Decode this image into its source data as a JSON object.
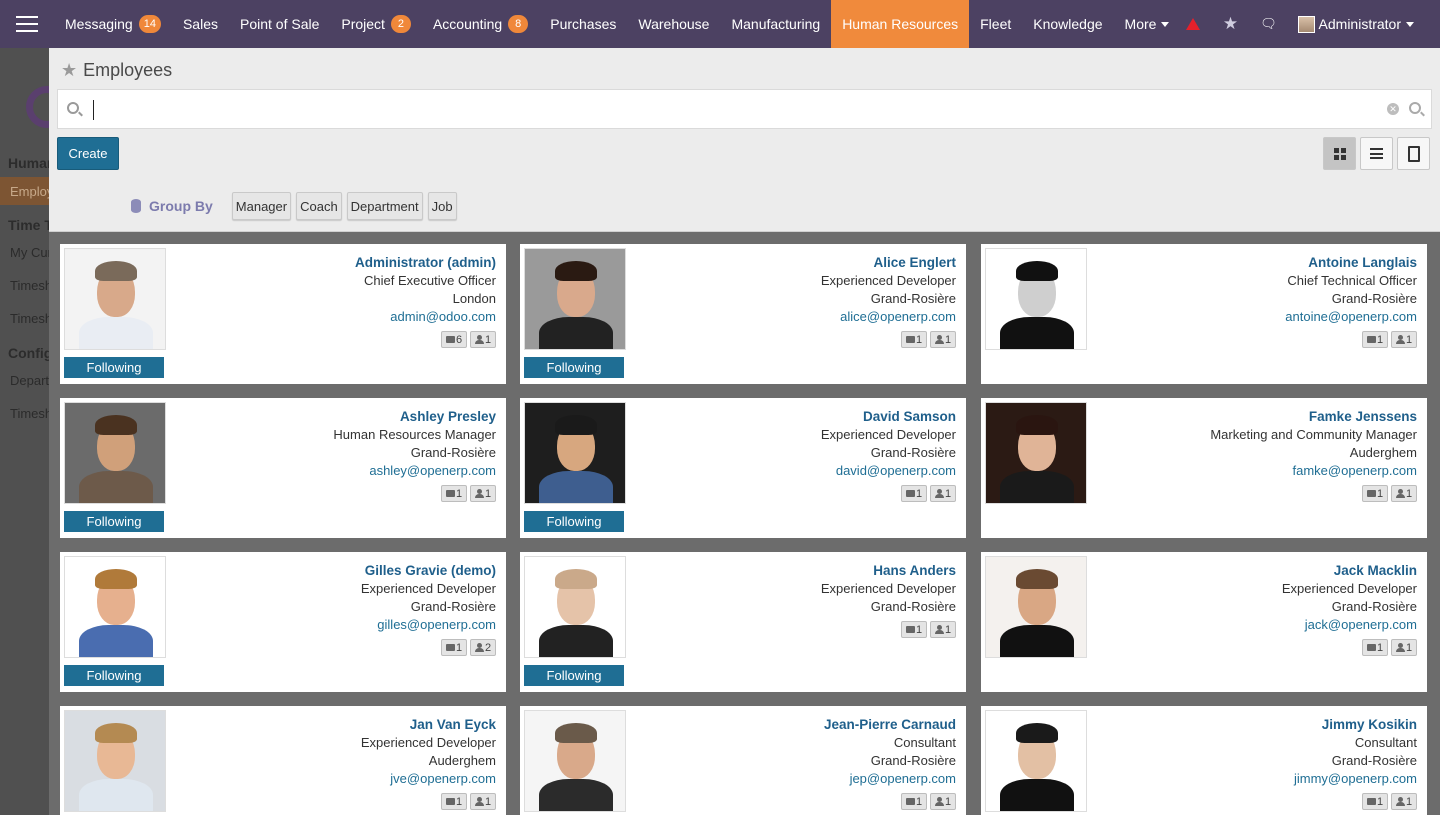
{
  "navbar": {
    "menus": [
      {
        "label": "Messaging",
        "badge": "14"
      },
      {
        "label": "Sales",
        "badge": ""
      },
      {
        "label": "Point of Sale",
        "badge": ""
      },
      {
        "label": "Project",
        "badge": "2"
      },
      {
        "label": "Accounting",
        "badge": "8"
      },
      {
        "label": "Purchases",
        "badge": ""
      },
      {
        "label": "Warehouse",
        "badge": ""
      },
      {
        "label": "Manufacturing",
        "badge": ""
      },
      {
        "label": "Human Resources",
        "badge": "",
        "active": true
      },
      {
        "label": "Fleet",
        "badge": ""
      },
      {
        "label": "Knowledge",
        "badge": ""
      },
      {
        "label": "More",
        "badge": ""
      }
    ],
    "user": "Administrator",
    "accent_color": "#4c4162",
    "active_color": "#f08a3c"
  },
  "sidebar": {
    "items": [
      {
        "label": "Human Resources",
        "type": "head"
      },
      {
        "label": "Employees",
        "type": "active"
      },
      {
        "label": "Time Tracking",
        "type": "head"
      },
      {
        "label": "My Current Timesheet",
        "type": "item"
      },
      {
        "label": "Timesheets",
        "type": "item"
      },
      {
        "label": "Timesheets",
        "type": "item"
      },
      {
        "label": "Configuration",
        "type": "head"
      },
      {
        "label": "Departments",
        "type": "item"
      },
      {
        "label": "Timesheets",
        "type": "item"
      }
    ]
  },
  "control": {
    "title": "Employees",
    "search_value": "",
    "create_label": "Create",
    "group_by_label": "Group By",
    "group_by_options": [
      "Manager",
      "Coach",
      "Department",
      "Job"
    ]
  },
  "employees": [
    {
      "name": "Administrator (admin)",
      "job": "Chief Executive Officer",
      "city": "London",
      "email": "admin@odoo.com",
      "messages": "6",
      "followers": "1",
      "following": true,
      "follow_label": "Following"
    },
    {
      "name": "Alice Englert",
      "job": "Experienced Developer",
      "city": "Grand-Rosière",
      "email": "alice@openerp.com",
      "messages": "1",
      "followers": "1",
      "following": true,
      "follow_label": "Following"
    },
    {
      "name": "Antoine Langlais",
      "job": "Chief Technical Officer",
      "city": "Grand-Rosière",
      "email": "antoine@openerp.com",
      "messages": "1",
      "followers": "1",
      "following": false,
      "follow_label": ""
    },
    {
      "name": "Ashley Presley",
      "job": "Human Resources Manager",
      "city": "Grand-Rosière",
      "email": "ashley@openerp.com",
      "messages": "1",
      "followers": "1",
      "following": true,
      "follow_label": "Following"
    },
    {
      "name": "David Samson",
      "job": "Experienced Developer",
      "city": "Grand-Rosière",
      "email": "david@openerp.com",
      "messages": "1",
      "followers": "1",
      "following": true,
      "follow_label": "Following"
    },
    {
      "name": "Famke Jenssens",
      "job": "Marketing and Community Manager",
      "city": "Auderghem",
      "email": "famke@openerp.com",
      "messages": "1",
      "followers": "1",
      "following": false,
      "follow_label": ""
    },
    {
      "name": "Gilles Gravie (demo)",
      "job": "Experienced Developer",
      "city": "Grand-Rosière",
      "email": "gilles@openerp.com",
      "messages": "1",
      "followers": "2",
      "following": true,
      "follow_label": "Following"
    },
    {
      "name": "Hans Anders",
      "job": "Experienced Developer",
      "city": "Grand-Rosière",
      "email": "",
      "messages": "1",
      "followers": "1",
      "following": true,
      "follow_label": "Following"
    },
    {
      "name": "Jack Macklin",
      "job": "Experienced Developer",
      "city": "Grand-Rosière",
      "email": "jack@openerp.com",
      "messages": "1",
      "followers": "1",
      "following": false,
      "follow_label": ""
    },
    {
      "name": "Jan Van Eyck",
      "job": "Experienced Developer",
      "city": "Auderghem",
      "email": "jve@openerp.com",
      "messages": "1",
      "followers": "1",
      "following": false,
      "follow_label": ""
    },
    {
      "name": "Jean-Pierre Carnaud",
      "job": "Consultant",
      "city": "Grand-Rosière",
      "email": "jep@openerp.com",
      "messages": "1",
      "followers": "1",
      "following": false,
      "follow_label": ""
    },
    {
      "name": "Jimmy Kosikin",
      "job": "Consultant",
      "city": "Grand-Rosière",
      "email": "jimmy@openerp.com",
      "messages": "1",
      "followers": "1",
      "following": false,
      "follow_label": ""
    }
  ]
}
